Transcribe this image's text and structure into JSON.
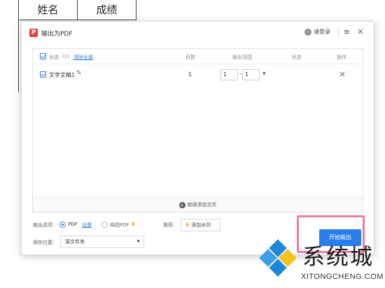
{
  "background_table": {
    "col_name": "姓名",
    "col_score": "成绩"
  },
  "dialog": {
    "title": "输出为PDF",
    "login_label": "请登录",
    "menu_glyph": "≡",
    "close_glyph": "×"
  },
  "file_list": {
    "select_all_label": "全选",
    "select_all_count": "(1)",
    "clear_all_label": "清除全部",
    "columns": {
      "pages": "页数",
      "range": "输出范围",
      "status": "状态",
      "actions": "操作"
    },
    "rows": [
      {
        "name": "文字文稿1",
        "pages": "1",
        "range_from": "1",
        "range_to": "1",
        "range_sep": "~",
        "delete_glyph": "×"
      }
    ],
    "add_more_label": "继续添加文件"
  },
  "options": {
    "output_label": "输出选项：",
    "pdf_label": "PDF",
    "settings_link": "设置",
    "image_pdf_label": "纯图PDF",
    "recommend_label": "推荐：",
    "watermark_button": "添加水印",
    "save_location_label": "保存位置：",
    "save_location_value": "源文件夹"
  },
  "start_button": "开始输出",
  "site_watermark": {
    "text": "系统城",
    "domain": "XITONGCHENG.COM"
  },
  "colors": {
    "accent": "#2b7de9",
    "highlight": "#f07aa6",
    "crown": "#f0a020"
  }
}
